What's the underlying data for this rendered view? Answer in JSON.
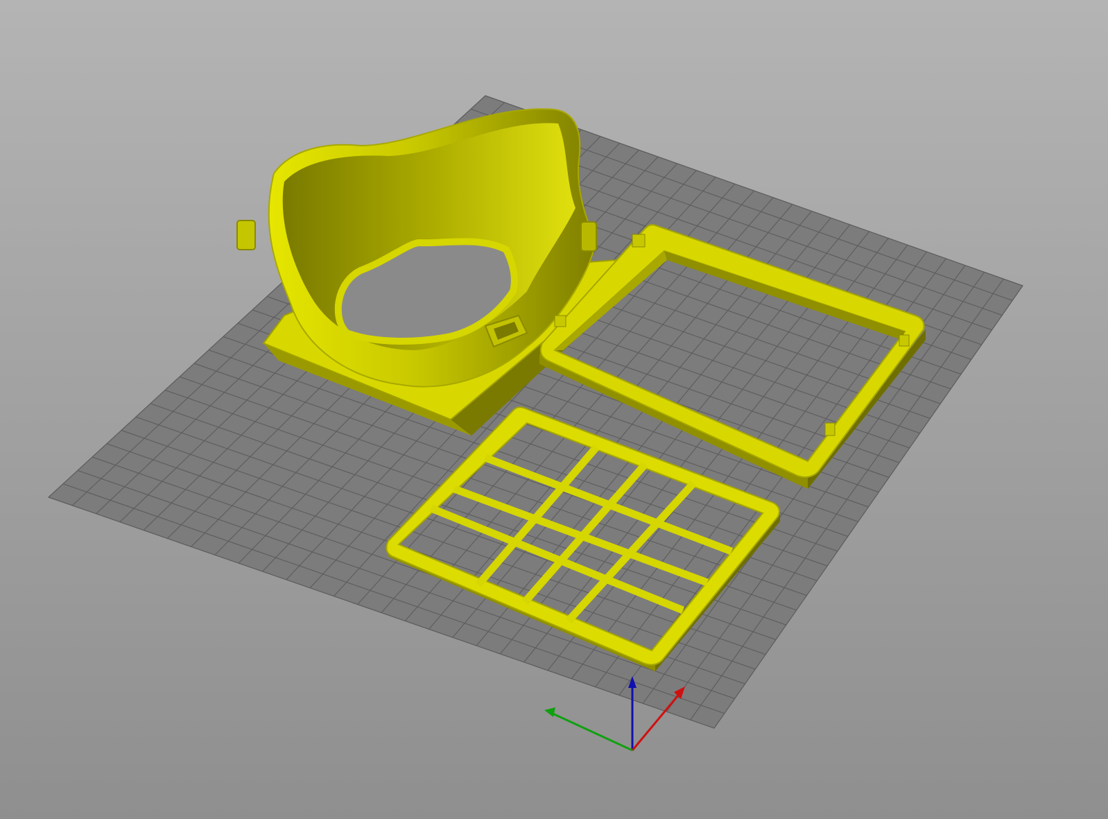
{
  "scene": {
    "background_top": "#b4b4b4",
    "background_bottom": "#8f8f8f",
    "bed_color": "#7c7c7c",
    "grid_color": "#5e5e5e",
    "model_color": "#e0e000",
    "model_shade": "#8f8f00",
    "model_dark": "#6b6b00"
  },
  "axes": {
    "x_color": "#d01010",
    "y_color": "#10a010",
    "z_color": "#1010b0"
  },
  "objects": [
    {
      "name": "mask-shell"
    },
    {
      "name": "filter-frame"
    },
    {
      "name": "filter-grid"
    }
  ]
}
